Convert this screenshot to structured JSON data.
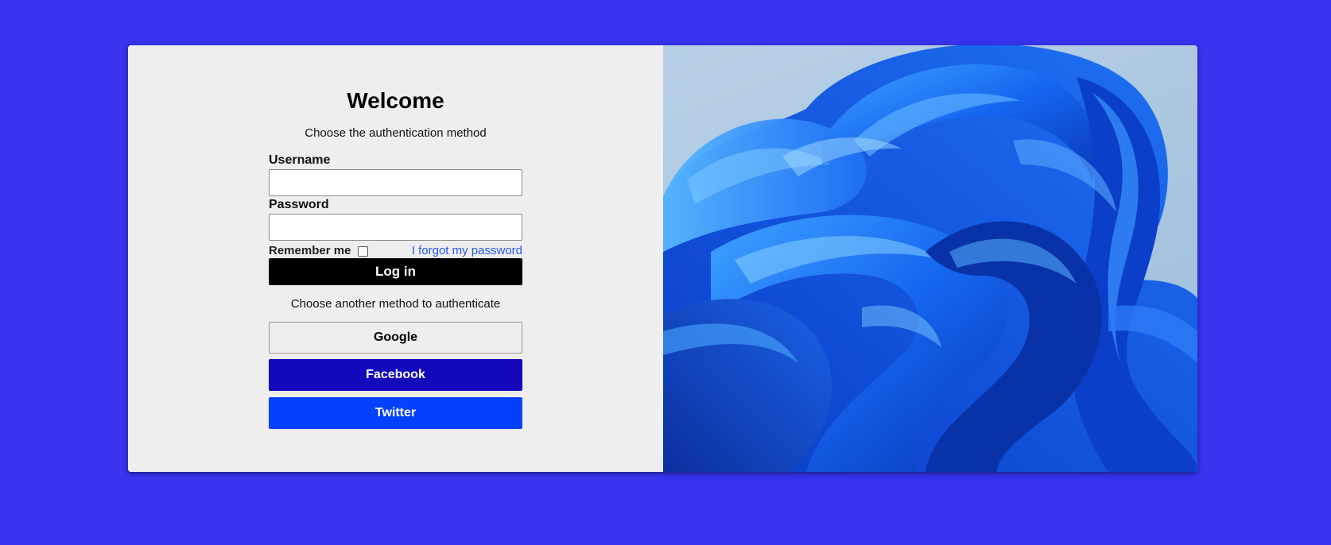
{
  "login": {
    "title": "Welcome",
    "subtitle": "Choose the authentication method",
    "username_label": "Username",
    "username_value": "",
    "password_label": "Password",
    "password_value": "",
    "remember_label": "Remember me",
    "remember_checked": false,
    "forgot_link": "I forgot my password",
    "login_button": "Log in",
    "alt_text": "Choose another method to authenticate",
    "google_button": "Google",
    "facebook_button": "Facebook",
    "twitter_button": "Twitter"
  },
  "colors": {
    "page_background": "#3733ee",
    "card_background": "#eeeeee",
    "login_button": "#000000",
    "facebook_button": "#1408bd",
    "twitter_button": "#0540fc",
    "link": "#2a55ee"
  },
  "hero": {
    "icon": "blue-bloom-wallpaper-image"
  }
}
